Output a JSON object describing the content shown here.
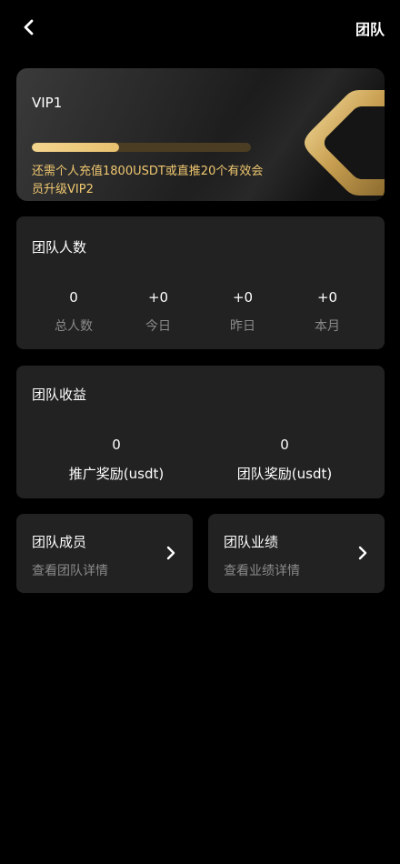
{
  "header": {
    "title": "团队"
  },
  "vip": {
    "level": "VIP1",
    "progress": 0.4,
    "description": "还需个人充值1800USDT或直推20个有效会员升级VIP2"
  },
  "team_count": {
    "title": "团队人数",
    "stats": [
      {
        "value": "0",
        "label": "总人数"
      },
      {
        "value": "+0",
        "label": "今日"
      },
      {
        "value": "+0",
        "label": "昨日"
      },
      {
        "value": "+0",
        "label": "本月"
      }
    ]
  },
  "team_earnings": {
    "title": "团队收益",
    "items": [
      {
        "value": "0",
        "label": "推广奖励(usdt)"
      },
      {
        "value": "0",
        "label": "团队奖励(usdt)"
      }
    ]
  },
  "nav": [
    {
      "title": "团队成员",
      "subtitle": "查看团队详情"
    },
    {
      "title": "团队业绩",
      "subtitle": "查看业绩详情"
    }
  ],
  "colors": {
    "accent": "#f0c870",
    "card": "#222222",
    "muted": "#8a8a8a"
  }
}
